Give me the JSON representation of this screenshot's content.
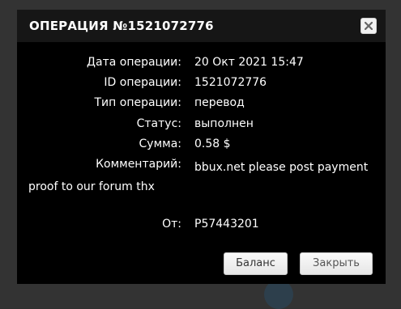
{
  "dialog": {
    "title": "ОПЕРАЦИЯ №1521072776",
    "close_icon": "close-icon"
  },
  "fields": {
    "date": {
      "label": "Дата операции:",
      "value": "20 Окт 2021 15:47"
    },
    "id": {
      "label": "ID операции:",
      "value": "1521072776"
    },
    "type": {
      "label": "Тип операции:",
      "value": "перевод"
    },
    "status": {
      "label": "Статус:",
      "value": "выполнен"
    },
    "amount": {
      "label": "Сумма:",
      "value": "0.58 $"
    },
    "comment": {
      "label": "Комментарий:",
      "value": "bbux.net please post payment proof to our forum thx"
    },
    "from": {
      "label": "От:",
      "value": "P57443201"
    }
  },
  "buttons": {
    "balance": "Баланс",
    "close": "Закрыть"
  },
  "colors": {
    "dialog_bg": "#000000",
    "header_bg": "#161616",
    "backdrop": "#333333"
  }
}
